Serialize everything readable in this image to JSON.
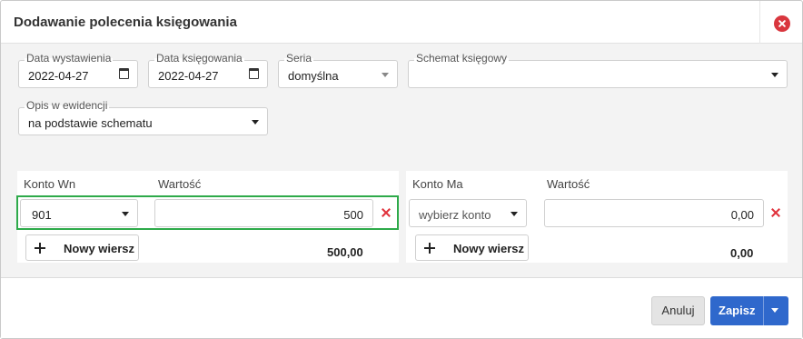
{
  "dialog": {
    "title": "Dodawanie polecenia księgowania"
  },
  "form": {
    "issue_date": {
      "label": "Data wystawienia",
      "value": "2022-04-27"
    },
    "posting_date": {
      "label": "Data księgowania",
      "value": "2022-04-27"
    },
    "series": {
      "label": "Seria",
      "value": "domyślna"
    },
    "scheme": {
      "label": "Schemat księgowy",
      "value": ""
    },
    "register_desc": {
      "label": "Opis w ewidencji",
      "value": "na podstawie schematu"
    }
  },
  "debit": {
    "account_label": "Konto Wn",
    "amount_label": "Wartość",
    "rows": [
      {
        "account": "901",
        "amount": "500"
      }
    ],
    "add_row_label": "Nowy wiersz",
    "total": "500,00"
  },
  "credit": {
    "account_label": "Konto Ma",
    "amount_label": "Wartość",
    "rows": [
      {
        "account_placeholder": "wybierz konto",
        "amount": "0,00"
      }
    ],
    "add_row_label": "Nowy wiersz",
    "total": "0,00"
  },
  "footer": {
    "cancel_label": "Anuluj",
    "save_label": "Zapisz"
  },
  "colors": {
    "primary": "#2f68cc",
    "danger": "#d9363e",
    "highlight": "#2eaa4a"
  },
  "icons": {
    "close": "close-circle-icon",
    "calendar": "calendar-icon",
    "dropdown": "caret-down-icon",
    "remove": "x-icon",
    "add": "plus-icon"
  }
}
